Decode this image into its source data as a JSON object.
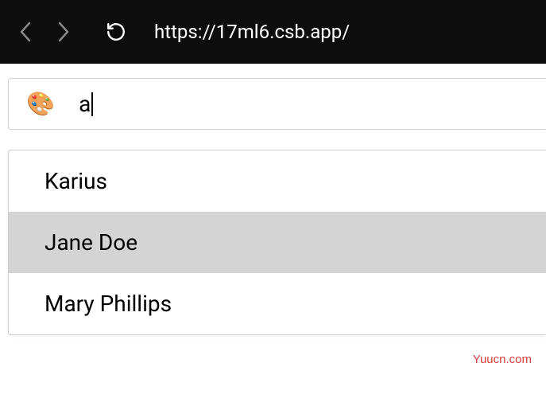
{
  "browser": {
    "url": "https://17ml6.csb.app/"
  },
  "search": {
    "icon": "🎨",
    "value": "a"
  },
  "suggestions": [
    {
      "label": "Karius",
      "highlighted": false
    },
    {
      "label": "Jane Doe",
      "highlighted": true
    },
    {
      "label": "Mary Phillips",
      "highlighted": false
    }
  ],
  "watermark": "Yuucn.com"
}
